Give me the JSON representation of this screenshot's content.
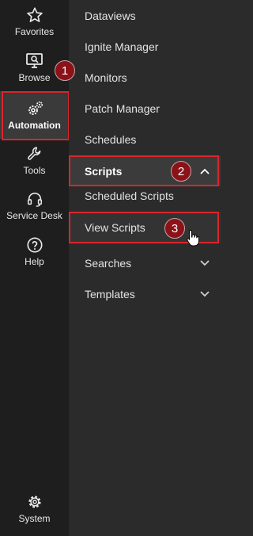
{
  "rail": {
    "favorites": {
      "label": "Favorites",
      "icon": "star-icon"
    },
    "browse": {
      "label": "Browse",
      "icon": "monitor-search-icon"
    },
    "automation": {
      "label": "Automation",
      "icon": "gears-icon"
    },
    "tools": {
      "label": "Tools",
      "icon": "wrench-icon"
    },
    "service_desk": {
      "label": "Service Desk",
      "icon": "headset-icon"
    },
    "help": {
      "label": "Help",
      "icon": "help-circle-icon"
    },
    "system": {
      "label": "System",
      "icon": "gear-icon"
    }
  },
  "menu": {
    "dataviews": "Dataviews",
    "ignite_manager": "Ignite Manager",
    "monitors": "Monitors",
    "patch_manager": "Patch Manager",
    "schedules": "Schedules",
    "scripts": "Scripts",
    "scheduled_scripts": "Scheduled Scripts",
    "view_scripts": "View Scripts",
    "searches": "Searches",
    "templates": "Templates"
  },
  "callouts": {
    "one": "1",
    "two": "2",
    "three": "3"
  },
  "colors": {
    "highlight": "#d8262c",
    "badge": "#8b1219",
    "rail_bg": "#1e1e1e",
    "panel_bg": "#2b2b2b"
  }
}
